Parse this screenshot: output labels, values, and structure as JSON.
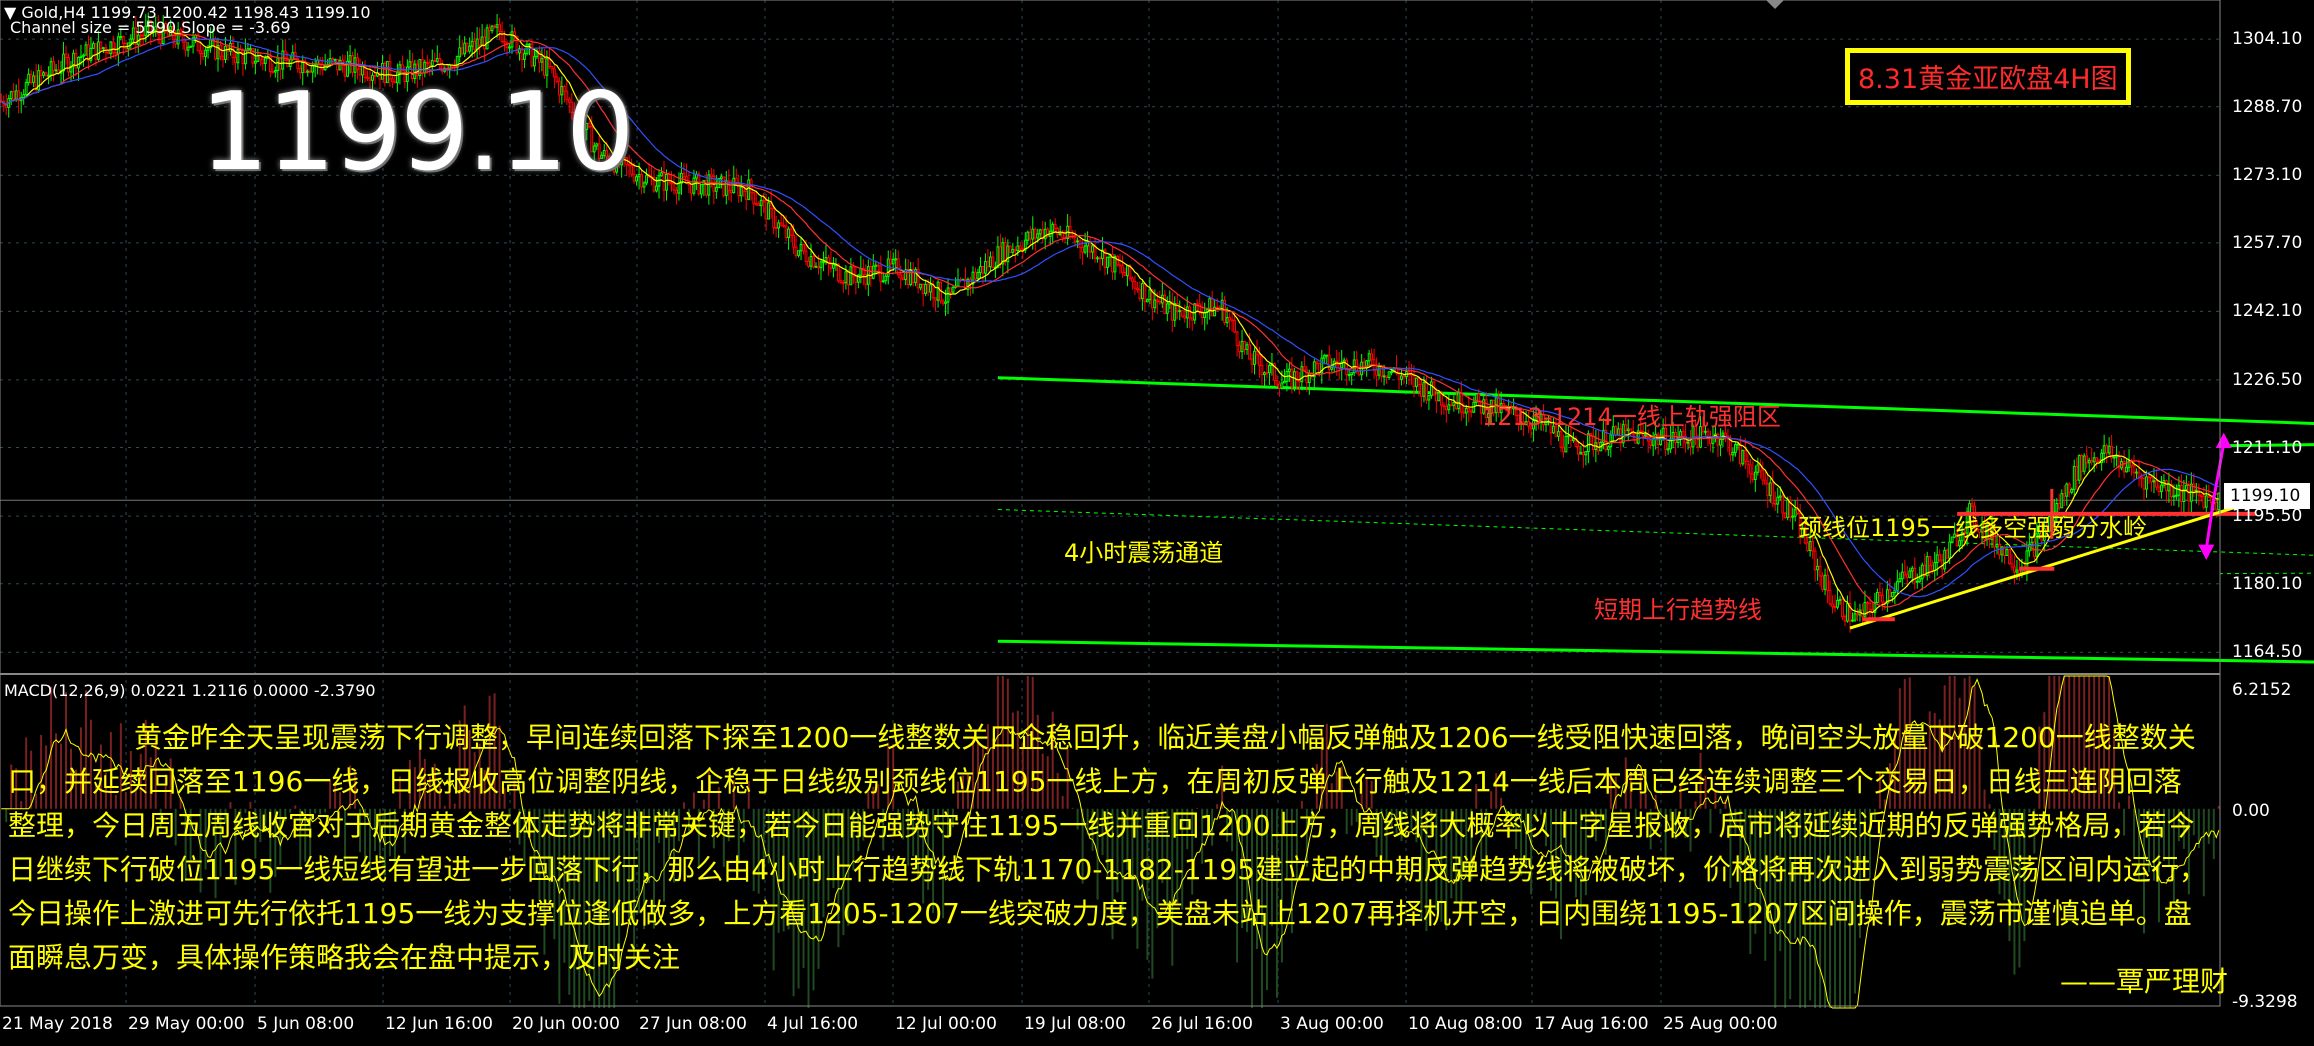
{
  "header": {
    "symbol_line": "Gold,H4  1199.73 1200.42 1198.43 1199.10",
    "channel_line": "Channel size = 5590 Slope = -3.69"
  },
  "big_price": "1199.10",
  "title_box": "8.31黄金亚欧盘4H图",
  "annotations": {
    "resistance": "1213-1214一线上轨强阻区",
    "channel": "4小时震荡通道",
    "neckline": "颈线位1195一线多空强弱分水岭",
    "trendline": "短期上行趋势线"
  },
  "macd_label": "MACD(12,26,9) 0.0221 1.2116 0.0000 -2.3790",
  "macd_scale": {
    "top": "6.2152",
    "zero": "0.00",
    "bottom": "-9.3298"
  },
  "current_price_tag": "1199.10",
  "commentary": "黄金昨全天呈现震荡下行调整，早间连续回落下探至1200一线整数关口企稳回升，临近美盘小幅反弹触及1206一线受阻快速回落，晚间空头放量下破1200一线整数关口，并延续回落至1196一线，日线报收高位调整阴线，企稳于日线级别颈线位1195一线上方，在周初反弹上行触及1214一线后本周已经连续调整三个交易日，日线三连阴回落整理，今日周五周线收官对于后期黄金整体走势将非常关键，若今日能强势守住1195一线并重回1200上方，周线将大概率以十字星报收，后市将延续近期的反弹强势格局，若今日继续下行破位1195一线短线有望进一步回落下行，那么由4小时上行趋势线下轨1170-1182-1195建立起的中期反弹趋势线将被破坏，价格将再次进入到弱势震荡区间内运行，今日操作上激进可先行依托1195一线为支撑位逢低做多，上方看1205-1207一线突破力度，美盘未站上1207再择机开空，日内围绕1195-1207区间操作，震荡市谨慎追单。盘面瞬息万变，具体操作策略我会在盘中提示，及时关注",
  "signature": "——覃严理财",
  "colors": {
    "background": "#000000",
    "bull_candle": "#00ff00",
    "bear_candle": "#ff0000",
    "channel_line": "#00ff00",
    "trendline": "#ffff00",
    "neckline": "#ff3030",
    "arrow": "#ff00ff",
    "title_border": "#ffff00",
    "commentary_text": "#ffff00",
    "grid": "#2b4a5a"
  },
  "chart_data": {
    "type": "candlestick",
    "symbol": "Gold",
    "timeframe": "H4",
    "ohlc_last": {
      "open": 1199.73,
      "high": 1200.42,
      "low": 1198.43,
      "close": 1199.1
    },
    "y_ticks": [
      "1304.10",
      "1288.70",
      "1273.10",
      "1257.70",
      "1242.10",
      "1226.50",
      "1211.10",
      "1195.50",
      "1180.10",
      "1164.50"
    ],
    "y_range": [
      1160,
      1313
    ],
    "x_ticks": [
      "21 May 2018",
      "29 May 00:00",
      "5 Jun 08:00",
      "12 Jun 16:00",
      "20 Jun 00:00",
      "27 Jun 08:00",
      "4 Jul 16:00",
      "12 Jul 00:00",
      "19 Jul 08:00",
      "26 Jul 16:00",
      "3 Aug 00:00",
      "10 Aug 08:00",
      "17 Aug 16:00",
      "25 Aug 00:00"
    ],
    "close_path": [
      [
        0,
        1290
      ],
      [
        30,
        1300
      ],
      [
        60,
        1306
      ],
      [
        90,
        1301
      ],
      [
        110,
        1299
      ],
      [
        140,
        1298
      ],
      [
        160,
        1296
      ],
      [
        180,
        1299
      ],
      [
        200,
        1306
      ],
      [
        220,
        1297
      ],
      [
        240,
        1278
      ],
      [
        260,
        1272
      ],
      [
        280,
        1271
      ],
      [
        300,
        1270
      ],
      [
        320,
        1256
      ],
      [
        340,
        1250
      ],
      [
        360,
        1252
      ],
      [
        380,
        1245
      ],
      [
        400,
        1255
      ],
      [
        420,
        1261
      ],
      [
        440,
        1256
      ],
      [
        460,
        1246
      ],
      [
        470,
        1242
      ],
      [
        490,
        1243
      ],
      [
        500,
        1232
      ],
      [
        515,
        1226
      ],
      [
        530,
        1230
      ],
      [
        550,
        1230
      ],
      [
        560,
        1228
      ],
      [
        580,
        1222
      ],
      [
        600,
        1220
      ],
      [
        620,
        1216
      ],
      [
        630,
        1211
      ],
      [
        650,
        1214
      ],
      [
        670,
        1213
      ],
      [
        690,
        1214
      ],
      [
        700,
        1208
      ],
      [
        720,
        1195
      ],
      [
        735,
        1176
      ],
      [
        745,
        1172
      ],
      [
        760,
        1180
      ],
      [
        780,
        1186
      ],
      [
        790,
        1196
      ],
      [
        800,
        1190
      ],
      [
        810,
        1184
      ],
      [
        820,
        1192
      ],
      [
        835,
        1208
      ],
      [
        845,
        1210
      ],
      [
        860,
        1204
      ],
      [
        875,
        1201
      ],
      [
        890,
        1199.1
      ]
    ],
    "channel_upper": [
      [
        400,
        1227
      ],
      [
        1110,
        1213
      ]
    ],
    "channel_lower": [
      [
        400,
        1167
      ],
      [
        960,
        1162
      ]
    ],
    "channel_mid": [
      [
        400,
        1197
      ],
      [
        1110,
        1183
      ]
    ],
    "resistance_zone": 1213.5,
    "neckline": 1196,
    "trendline": [
      [
        742,
        1170
      ],
      [
        922,
        1202
      ]
    ],
    "macd_range": [
      -9.3298,
      6.2152
    ]
  }
}
